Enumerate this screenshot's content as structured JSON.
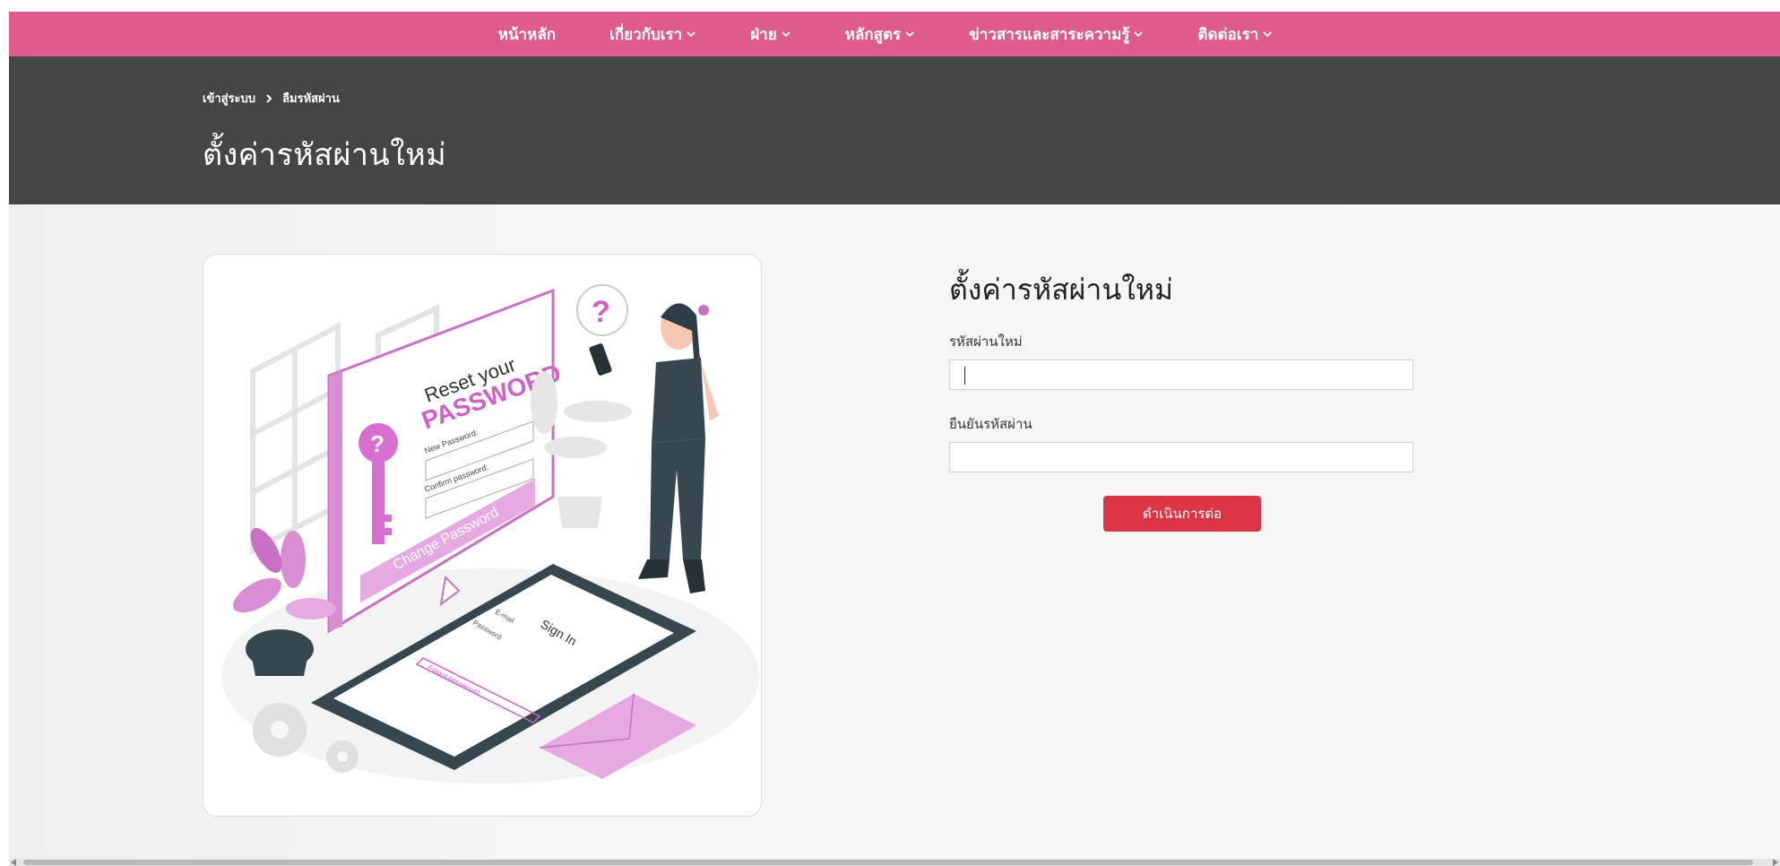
{
  "nav": {
    "items": [
      {
        "label": "หน้าหลัก",
        "has_dropdown": false
      },
      {
        "label": "เกี่ยวกับเรา",
        "has_dropdown": true
      },
      {
        "label": "ฝ่าย",
        "has_dropdown": true
      },
      {
        "label": "หลักสูตร",
        "has_dropdown": true
      },
      {
        "label": "ข่าวสารและสาระความรู้",
        "has_dropdown": true
      },
      {
        "label": "ติดต่อเรา",
        "has_dropdown": true
      }
    ]
  },
  "breadcrumb": {
    "items": [
      "เข้าสู่ระบบ",
      "ลืมรหัสผ่าน"
    ],
    "separator_icon": "chevron-right-icon"
  },
  "hero": {
    "title": "ตั้งค่ารหัสผ่านใหม่"
  },
  "illustration": {
    "heading_line1": "Reset your",
    "heading_line2": "PASSWORD",
    "new_password_label": "New Password:",
    "confirm_password_label": "Confirm password:",
    "change_button": "Change Password",
    "sign_in": "Sign In",
    "email_label": "E-mail",
    "password_label": "Password",
    "forgot_link": "Forgot password?",
    "question_mark": "?"
  },
  "form": {
    "title": "ตั้งค่ารหัสผ่านใหม่",
    "new_password_label": "รหัสผ่านใหม่",
    "new_password_value": "",
    "confirm_password_label": "ยืนยันรหัสผ่าน",
    "confirm_password_value": "",
    "submit_label": "ดำเนินการต่อ"
  },
  "colors": {
    "nav_bg": "#df5b8a",
    "hero_bg": "#454545",
    "submit_bg": "#dc3545",
    "accent_pink": "#d86fd0",
    "accent_dark": "#37474f"
  }
}
